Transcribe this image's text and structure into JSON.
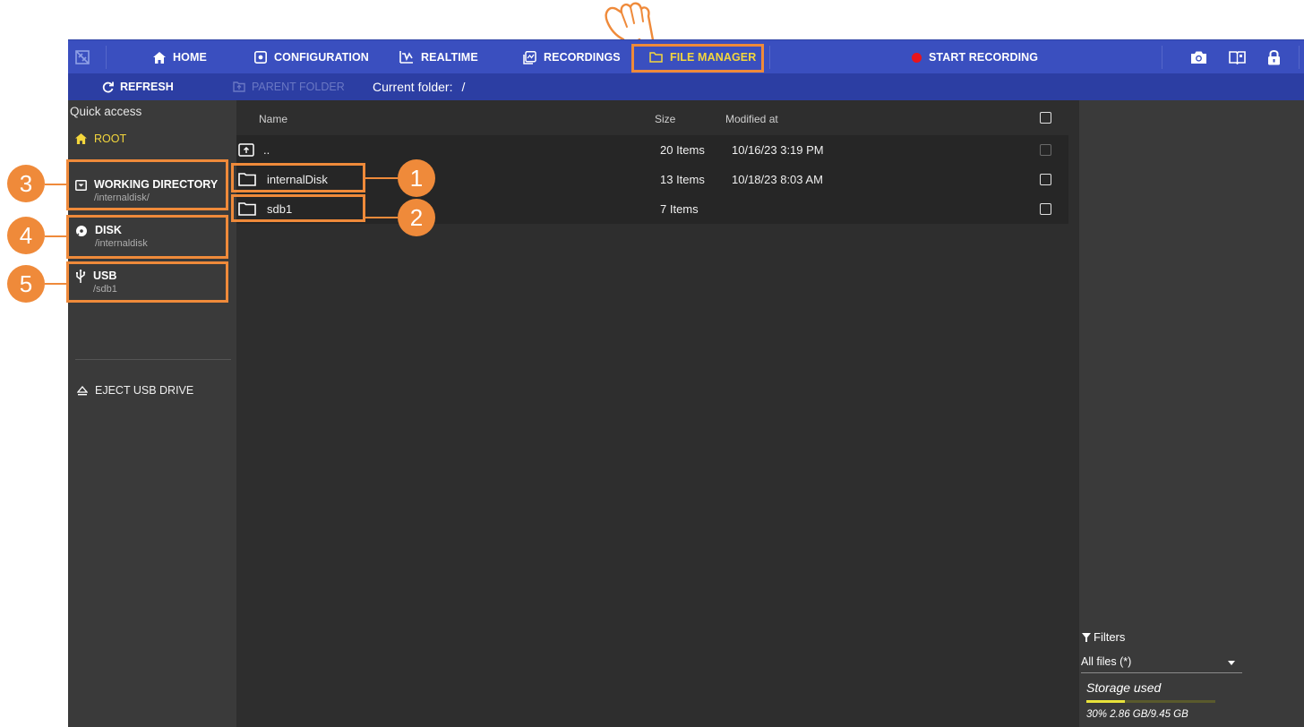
{
  "topbar": {
    "nav": [
      {
        "label": "HOME",
        "icon": "home-icon"
      },
      {
        "label": "CONFIGURATION",
        "icon": "configuration-icon"
      },
      {
        "label": "REALTIME",
        "icon": "realtime-icon"
      },
      {
        "label": "RECORDINGS",
        "icon": "recordings-icon"
      },
      {
        "label": "FILE MANAGER",
        "icon": "folder-icon",
        "active": true
      }
    ],
    "start_recording": "START RECORDING",
    "tools": [
      "camera-icon",
      "book-icon",
      "lock-icon"
    ]
  },
  "subbar": {
    "refresh": "REFRESH",
    "parent_folder": "PARENT FOLDER",
    "current_folder_label": "Current folder:",
    "current_folder_value": "/"
  },
  "sidebar": {
    "heading": "Quick access",
    "items": [
      {
        "label": "ROOT",
        "path": ""
      },
      {
        "label": "WORKING DIRECTORY",
        "path": "/internaldisk/"
      },
      {
        "label": "DISK",
        "path": "/internaldisk"
      },
      {
        "label": "USB",
        "path": "/sdb1"
      }
    ],
    "eject": "EJECT USB DRIVE"
  },
  "filelist": {
    "columns": {
      "name": "Name",
      "size": "Size",
      "modified": "Modified at"
    },
    "rows": [
      {
        "name": "..",
        "size": "20 Items",
        "modified": "10/16/23 3:19 PM"
      },
      {
        "name": "internalDisk",
        "size": "13 Items",
        "modified": "10/18/23 8:03 AM"
      },
      {
        "name": "sdb1",
        "size": "7 Items",
        "modified": ""
      }
    ]
  },
  "rightpanel": {
    "filters_label": "Filters",
    "filter_value": "All files (*)",
    "storage_label": "Storage used",
    "storage_text": "30% 2.86 GB/9.45 GB",
    "storage_fraction": 0.3
  },
  "callouts": [
    "1",
    "2",
    "3",
    "4",
    "5"
  ],
  "colors": {
    "accent": "#ef8a3a",
    "topbar": "#3a4fbf",
    "active": "#f4d73c",
    "record": "#e8141c"
  }
}
